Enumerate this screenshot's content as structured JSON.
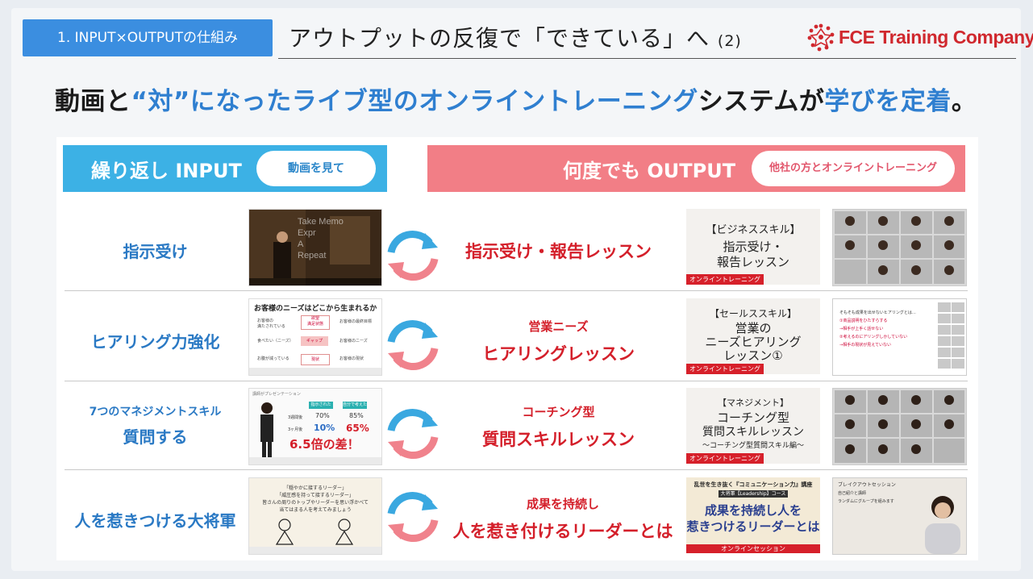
{
  "header": {
    "section_tag": "1. INPUT×OUTPUTの仕組み",
    "title": "アウトプットの反復で「できている」へ",
    "title_num": "(2)",
    "logo_text": "FCE Training Company"
  },
  "headline": {
    "part1": "動画と",
    "part2": "“対”になったライブ型のオンライントレーニング",
    "part3": "システムが",
    "part4": "学びを定着",
    "part5": "。"
  },
  "banners": {
    "input_label": "繰り返し INPUT",
    "input_pill": "動画を見て",
    "output_label": "何度でも OUTPUT",
    "output_pill": "他社の方とオンライントレーニング"
  },
  "rows": [
    {
      "topic": "指示受け",
      "lesson_sub": "",
      "lesson_main": "指示受け・報告レッスン",
      "card_lines": [
        "【ビジネススキル】",
        "指示受け・",
        "報告レッスン"
      ],
      "card_tag": "オンライントレーニング"
    },
    {
      "topic": "ヒアリング力強化",
      "lesson_sub": "営業ニーズ",
      "lesson_main": "ヒアリングレッスン",
      "card_lines": [
        "【セールススキル】",
        "営業の",
        "ニーズヒアリング",
        "レッスン①"
      ],
      "card_tag": "オンライントレーニング",
      "thumb": {
        "heading": "お客様のニーズはどこから生まれるか",
        "left1": "お客様の",
        "left1b": "満たされている",
        "left2": "食べたい（ニーズ）",
        "left3": "お腹が減っている",
        "box1": "欲望",
        "box1b": "満足状態",
        "box2": "ギャップ",
        "box3": "現状",
        "right1": "お客様の最終目標",
        "right2": "お客様のニーズ",
        "right3": "お客様の現状"
      },
      "zoom_text": [
        "そもそも成果を出せないヒアリングとは…",
        "①商品説明をひたすらする",
        "→相手が上手く話せない",
        "②考えるのにアリングしかしていない",
        "→相手の現状が見えていない"
      ]
    },
    {
      "topic_small": "7つのマネジメントスキル",
      "topic": "質問する",
      "lesson_sub": "コーチング型",
      "lesson_main": "質問スキルレッスン",
      "card_lines": [
        "【マネジメント】",
        "コーチング型",
        "質問スキルレッスン",
        "〜コーチング型質問スキル編〜"
      ],
      "card_tag": "オンライントレーニング",
      "thumb": {
        "caption": "講師がプレゼンテーション",
        "col1": "指示された",
        "col2": "自分で考えた",
        "r1": "3週間後",
        "r1a": "70%",
        "r1b": "85%",
        "r2": "3ヶ月後",
        "r2a": "10%",
        "r2b": "65%",
        "big": "6.5倍の差！"
      }
    },
    {
      "topic": "人を惹きつける大将軍",
      "lesson_sub": "成果を持続し",
      "lesson_main": "人を惹き付けるリーダーとは",
      "card_top": "乱世を生き抜く『コミュニケーション力』講座",
      "card_mid": "大将軍【Leadership】コース",
      "card_big1": "成果を持続し人を",
      "card_big2": "惹きつけるリーダーとは",
      "card_tag": "オンラインセッション",
      "thumb": {
        "l1": "「穏やかに接するリーダー」",
        "l2": "「威圧感を持って接するリーダー」",
        "l3": "皆さんの周りのトップやリーダーを思い浮かべて",
        "l4": "当てはまる人を考えてみましょう"
      },
      "zoom_text": [
        "ブレイクアウトセッション",
        "自己紹介と講師",
        "ランダムにグループを組みます"
      ]
    }
  ],
  "thumb1_overlay": {
    "lines": [
      "Take Memo",
      "Expr",
      "A",
      "Repeat"
    ]
  },
  "colors": {
    "input_blue": "#3cb1e5",
    "output_pink": "#f27e86",
    "accent_red": "#d41f2a",
    "headline_blue": "#2f7fd0"
  }
}
